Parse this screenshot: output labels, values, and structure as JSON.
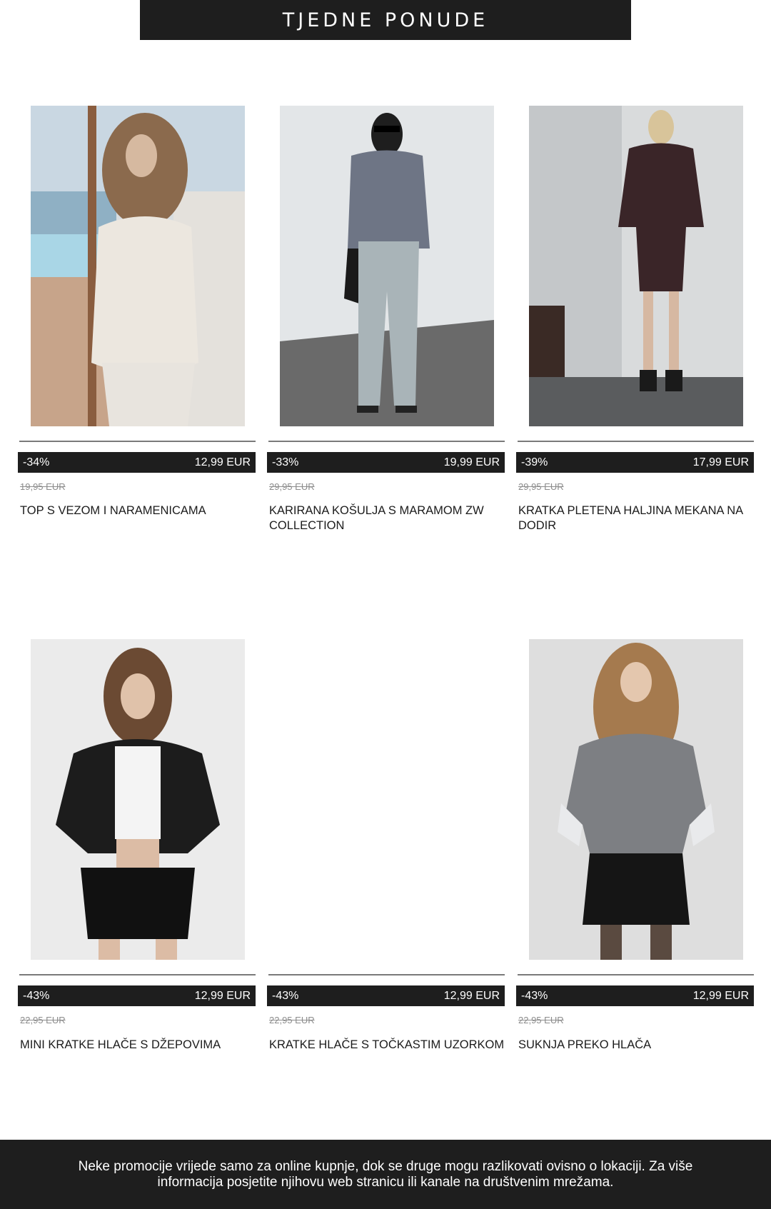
{
  "header": {
    "title": "TJEDNE PONUDE"
  },
  "products": [
    {
      "discount": "-34%",
      "price": "12,99 EUR",
      "old_price": "19,95 EUR",
      "title": "TOP S VEZOM I NARAMENICAMA",
      "image": "model-white-lace-top"
    },
    {
      "discount": "-33%",
      "price": "19,99 EUR",
      "old_price": "29,95 EUR",
      "title": "KARIRANA KOŠULJA S MARAMOM ZW COLLECTION",
      "image": "model-grey-shirt-jeans"
    },
    {
      "discount": "-39%",
      "price": "17,99 EUR",
      "old_price": "29,95 EUR",
      "title": "KRATKA PLETENA HALJINA MEKANA NA DODIR",
      "image": "model-knit-dress"
    },
    {
      "discount": "-43%",
      "price": "12,99 EUR",
      "old_price": "22,95 EUR",
      "title": "MINI KRATKE HLAČE S DŽEPOVIMA",
      "image": "model-leather-jacket-shorts"
    },
    {
      "discount": "-43%",
      "price": "12,99 EUR",
      "old_price": "22,95 EUR",
      "title": "KRATKE HLAČE S TOČKASTIM UZORKOM",
      "image": ""
    },
    {
      "discount": "-43%",
      "price": "12,99 EUR",
      "old_price": "22,95 EUR",
      "title": "SUKNJA PREKO HLAČA",
      "image": "model-grey-sweater-skirt"
    }
  ],
  "footer": {
    "text": "Neke promocije vrijede samo za online kupnje, dok se druge mogu razlikovati ovisno o lokaciji. Za više informacija posjetite njihovu web stranicu ili kanale na društvenim mrežama."
  },
  "colors": {
    "dark_bar": "#1e1e1e",
    "old_price": "#8c8c8c",
    "rule": "#7a7a7a"
  }
}
